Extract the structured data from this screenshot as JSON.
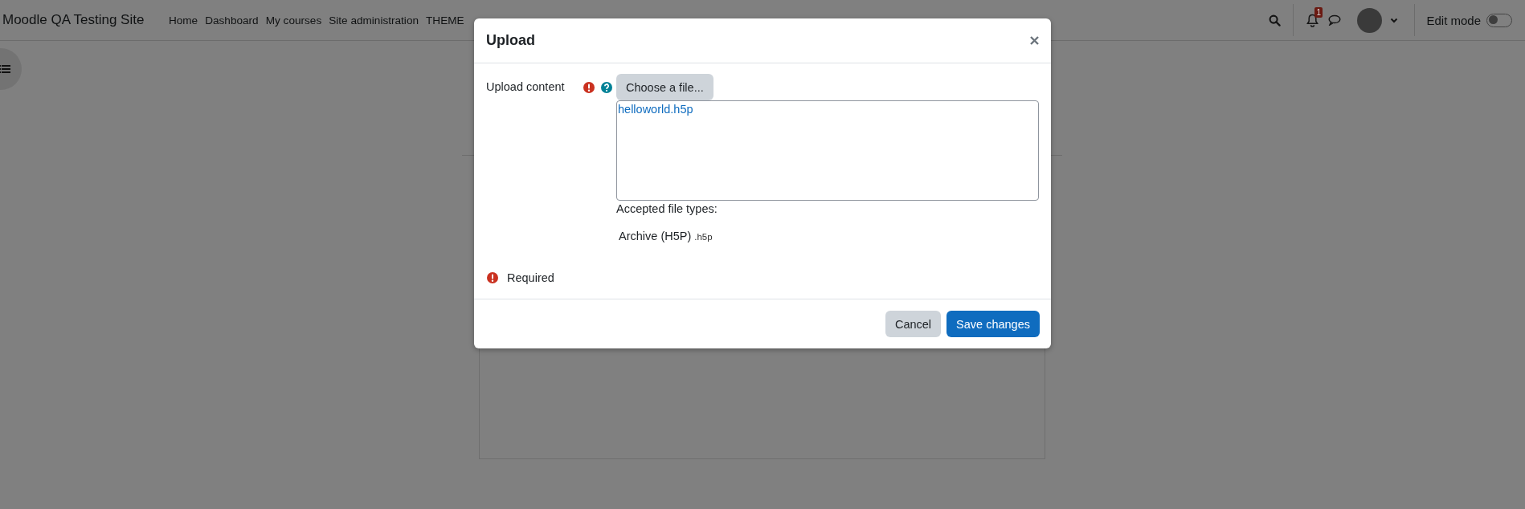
{
  "navbar": {
    "site_name": "Moodle QA Testing Site",
    "links": [
      "Home",
      "Dashboard",
      "My courses",
      "Site administration",
      "THEME"
    ],
    "notification_count": "1",
    "edit_mode": {
      "label": "Edit mode",
      "on": false
    }
  },
  "modal": {
    "title": "Upload",
    "field": {
      "label": "Upload content",
      "required": true,
      "choose_button": "Choose a file...",
      "files": [
        "helloworld.h5p"
      ],
      "accepted_label": "Accepted file types:",
      "accepted_types": [
        {
          "name": "Archive (H5P)",
          "extension": ".h5p"
        }
      ]
    },
    "required_note": "Required",
    "buttons": [
      {
        "label": "Cancel",
        "kind": "secondary"
      },
      {
        "label": "Save changes",
        "kind": "primary"
      }
    ]
  }
}
